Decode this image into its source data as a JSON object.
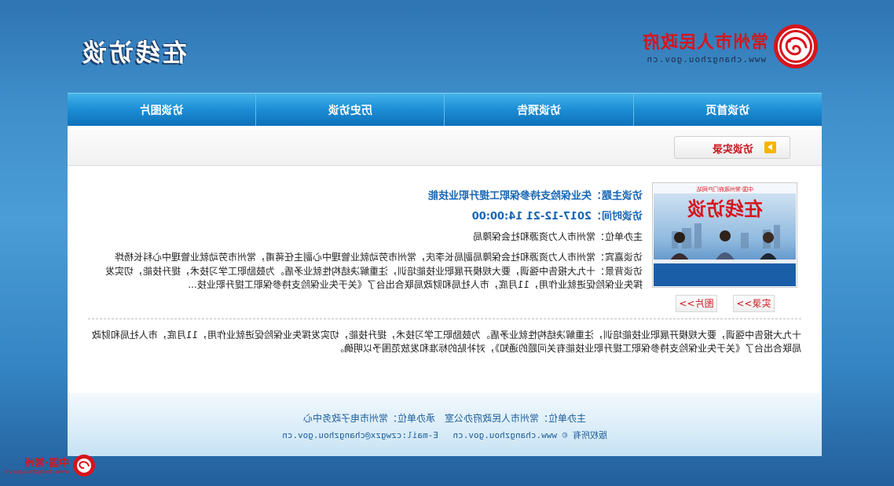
{
  "site": {
    "logo_name": "常州市人民政府",
    "logo_url": "www.changzhou.gov.cn",
    "page_title": "在线访谈"
  },
  "nav": [
    {
      "label": "访谈首页"
    },
    {
      "label": "访谈预告"
    },
    {
      "label": "历史访谈"
    },
    {
      "label": "访谈图片"
    }
  ],
  "section_tab": {
    "label": "访谈实录",
    "icon": "arrow-right-icon"
  },
  "photo": {
    "banner_text": "在线访谈",
    "banner_sub": "中国·常州政府门户网站"
  },
  "buttons": {
    "record": "实录>>",
    "pictures": "图片>>"
  },
  "interview": {
    "topic": "访谈主题：失业保险支持参保职工提升职业技能",
    "time": "访谈时间：2017-12-21 14:00:00",
    "host": "主办单位：常州市人力资源和社会保障局",
    "guests": "访谈嘉宾：常州市人力资源和社会保障局副局长李庆，常州市劳动就业管理中心副主任蒋甫，常州市劳动就业管理中心科长杨烨",
    "background": "访谈背景：十九大报告中强调，要大规模开展职业技能培训，注重解决结构性就业矛盾。为鼓励职工学习技术，提升技能，切实发挥失业保险促进就业作用，11月底，市人社局和财政局联合出台了《关于失业保险支持参保职工提升职业技..."
  },
  "summary": "十九大报告中强调，要大规模开展职业技能培训，注重解决结构性就业矛盾。为鼓励职工学习技术，提升技能，切实发挥失业保险促进就业作用，11月底，市人社局和财政局联合出台了《关于失业保险支持参保职工提升职业技能有关问题的通知》，对补贴的标准和发放范围予以明确。",
  "footer": {
    "line1": "主办单位：常州市人民政府办公室　承办单位：常州市电子政务中心",
    "copyright": "版权所有 © www.changzhou.gov.cn",
    "email": "E-mail:czwgzx@changzhou.gov.cn"
  },
  "corner_logo": {
    "name": "中国·常州",
    "url": "www.changzhou.gov.cn"
  },
  "colors": {
    "brand_red": "#d8141c",
    "nav_blue": "#1d8fd6",
    "link_blue": "#1766b5",
    "footer_text": "#1c5d9a"
  }
}
